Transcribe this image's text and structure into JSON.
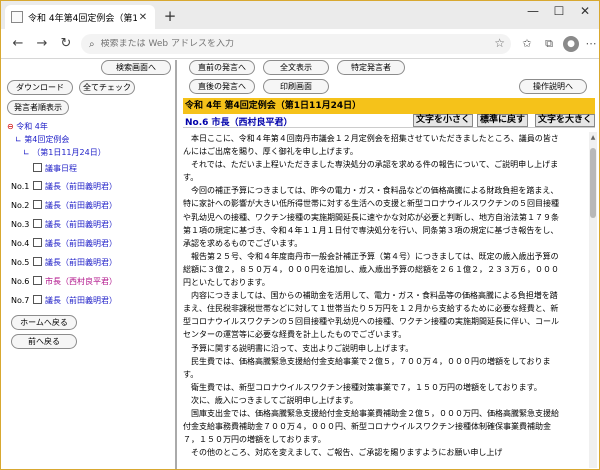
{
  "browser": {
    "tab_title": "令和 4年第4回定例会（第1日11/",
    "new_tab": "+",
    "minimize": "—",
    "maximize": "☐",
    "close": "✕",
    "address_placeholder": "検索または Web アドレスを入力"
  },
  "left": {
    "search_screen": "検索画面へ",
    "download": "ダウンロード",
    "check_all": "全てチェック",
    "show_speakers": "発言者順表示",
    "tree_year": "令和 4年",
    "tree_session": "第4回定例会",
    "tree_day": "（第1日11月24日）",
    "schedule": "議事日程",
    "speakers": [
      {
        "no": "No.1",
        "name": "議長（前田義明君）"
      },
      {
        "no": "No.2",
        "name": "議長（前田義明君）"
      },
      {
        "no": "No.3",
        "name": "議長（前田義明君）"
      },
      {
        "no": "No.4",
        "name": "議長（前田義明君）"
      },
      {
        "no": "No.5",
        "name": "議長（前田義明君）"
      },
      {
        "no": "No.6",
        "name": "市長（西村良平君）"
      },
      {
        "no": "No.7",
        "name": "議長（前田義明君）"
      }
    ],
    "home": "ホームへ戻る",
    "back": "前へ戻る"
  },
  "toolbar": {
    "prev_speech": "直前の発言へ",
    "full_text": "全文表示",
    "specific_speaker": "特定発言者",
    "next_speech": "直後の発言へ",
    "print": "印刷画面",
    "help": "操作説明へ"
  },
  "doc": {
    "header": "令和 4年 第4回定例会（第1日11月24日）",
    "speaker": "No.6 市長（西村良平君）",
    "smaller": "文字を小さく",
    "normal": "標準に戻す",
    "larger": "文字を大きく",
    "lines": [
      "　本日ここに、令和４年第４回南丹市議会１２月定例会を招集させていただきましたところ、議員の皆さ",
      "んにはご出席を賜り、厚く御礼を申し上げます。",
      "　それでは、ただいま上程いただきました専決処分の承認を求める件の報告について、ご説明申し上げま",
      "す。",
      "　今回の補正予算につきましては、昨今の電力・ガス・食料品などの価格高騰による財政負担を踏まえ、",
      "特に家計への影響が大きい低所得世帯に対する生活への支援と新型コロナウイルスワクチンの５回目接種",
      "や乳幼児への接種、ワクチン接種の実施期間延長に速やかな対応が必要と判断し、地方自治法第１７９条",
      "第１項の規定に基づき、令和４年１１月１日付で専決処分を行い、同条第３項の規定に基づき報告をし、",
      "承認を求めるものでございます。",
      "　報告第２５号、令和４年度南丹市一般会計補正予算（第４号）につきましては、既定の歳入歳出予算の",
      "総額に３億２，８５０万４，０００円を追加し、歳入歳出予算の総額を２６１億２，２３３万６，０００",
      "円といたしております。",
      "　内容につきましては、国からの補助金を活用して、電力・ガス・食料品等の価格高騰による負担増を踏",
      "まえ、住民税非課税世帯などに対して１世帯当たり５万円を１２月から支給するために必要な経費と、新",
      "型コロナウイルスワクチンの５回目接種や乳幼児への接種、ワクチン接種の実施期間延長に伴い、コール",
      "センターの運営等に必要な経費を計上したものでございます。",
      "　予算に関する説明書に沿って、支出よりご説明申し上げます。",
      "　民生費では、価格高騰緊急支援給付金支給事業で２億５，７００万４，０００円の増額をしておりま",
      "す。",
      "　衛生費では、新型コロナウイルスワクチン接種対策事業で７，１５０万円の増額をしております。",
      "　次に、歳入につきましてご説明申し上げます。",
      "　国庫支出金では、価格高騰緊急支援給付金支給事業費補助金２億５，０００万円、価格高騰緊急支援給",
      "付金支給事務費補助金７００万４，０００円、新型コロナウイルスワクチン接種体制確保事業費補助金",
      "７，１５０万円の増額をしております。",
      "　その他のところ、対応を変えまして、ご報告、ご承認を賜りますようにお願い申し上げ"
    ]
  }
}
